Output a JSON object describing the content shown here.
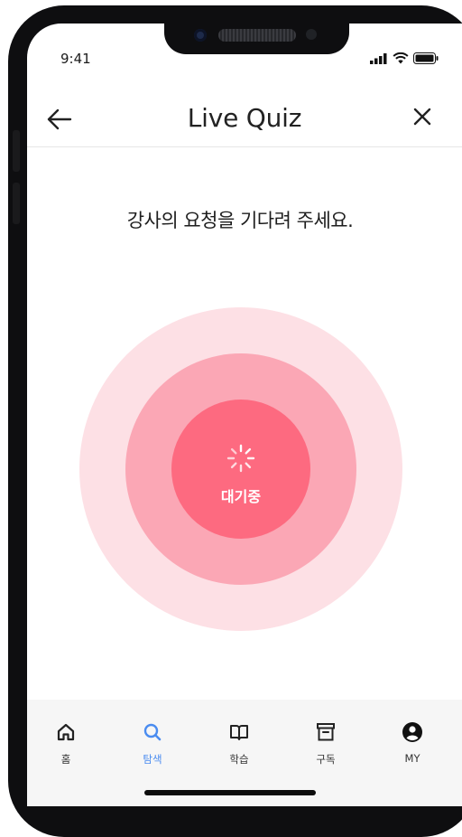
{
  "status": {
    "time": "9:41"
  },
  "header": {
    "title": "Live Quiz"
  },
  "main": {
    "prompt": "강사의 요청을 기다려 주세요.",
    "status_label": "대기중"
  },
  "tabs": [
    {
      "label": "홈",
      "icon": "home-icon",
      "active": false
    },
    {
      "label": "탐색",
      "icon": "search-icon",
      "active": true
    },
    {
      "label": "학습",
      "icon": "book-icon",
      "active": false
    },
    {
      "label": "구독",
      "icon": "archive-icon",
      "active": false
    },
    {
      "label": "MY",
      "icon": "user-icon",
      "active": false
    }
  ],
  "colors": {
    "ring_outer": "#fde0e5",
    "ring_middle": "#fba7b5",
    "ring_inner": "#fd6a80",
    "tab_active": "#4a8cf0"
  }
}
